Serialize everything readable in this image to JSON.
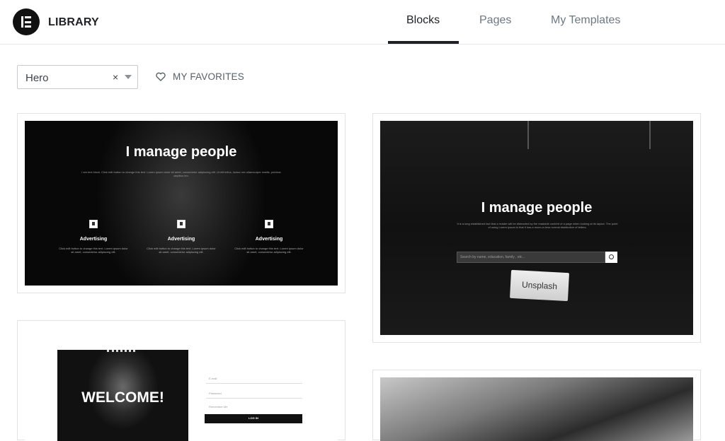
{
  "header": {
    "brand": "LIBRARY",
    "tabs": [
      {
        "label": "Blocks",
        "active": true
      },
      {
        "label": "Pages",
        "active": false
      },
      {
        "label": "My Templates",
        "active": false
      }
    ]
  },
  "toolbar": {
    "filter_value": "Hero",
    "clear_glyph": "×",
    "favorites_label": "MY FAVORITES"
  },
  "templates": [
    {
      "title": "I manage people",
      "subtitle": "I am text block. Click edit button to change this text. Lorem ipsum dolor sit amet, consectetur adipiscing elit. Ut elit tellus, luctus nec ullamcorper mattis, pulvinar dapibus leo.",
      "features": [
        {
          "title": "Advertising",
          "text": "Click edit button to change this text. Lorem ipsum dolor sit amet, consectetur adipiscing elit."
        },
        {
          "title": "Advertising",
          "text": "Click edit button to change this text. Lorem ipsum dolor sit amet, consectetur adipiscing elit."
        },
        {
          "title": "Advertising",
          "text": "Click edit button to change this text. Lorem ipsum dolor sit amet, consectetur adipiscing elit."
        }
      ]
    },
    {
      "title": "I manage people",
      "subtitle": "It is a long established fact that a reader will be distracted by the readable content of a page when looking at its layout. The point of using Lorem Ipsum is that it has a more-or-less normal distribution of letters.",
      "search_placeholder": "Search by name, education, family , etc...",
      "tag_text": "Unsplash"
    },
    {
      "title": "WELCOME!",
      "email_placeholder": "E-mail",
      "password_placeholder": "Password",
      "remember_label": "Remember Me",
      "login_label": "LOG IN"
    },
    {}
  ],
  "colors": {
    "accent": "#1f2124",
    "muted": "#6d7882",
    "border": "#e1e3e5"
  },
  "icons": {
    "logo": "elementor-logo-icon",
    "favorites": "heart-icon",
    "clear": "close-icon",
    "dropdown": "caret-down-icon"
  }
}
